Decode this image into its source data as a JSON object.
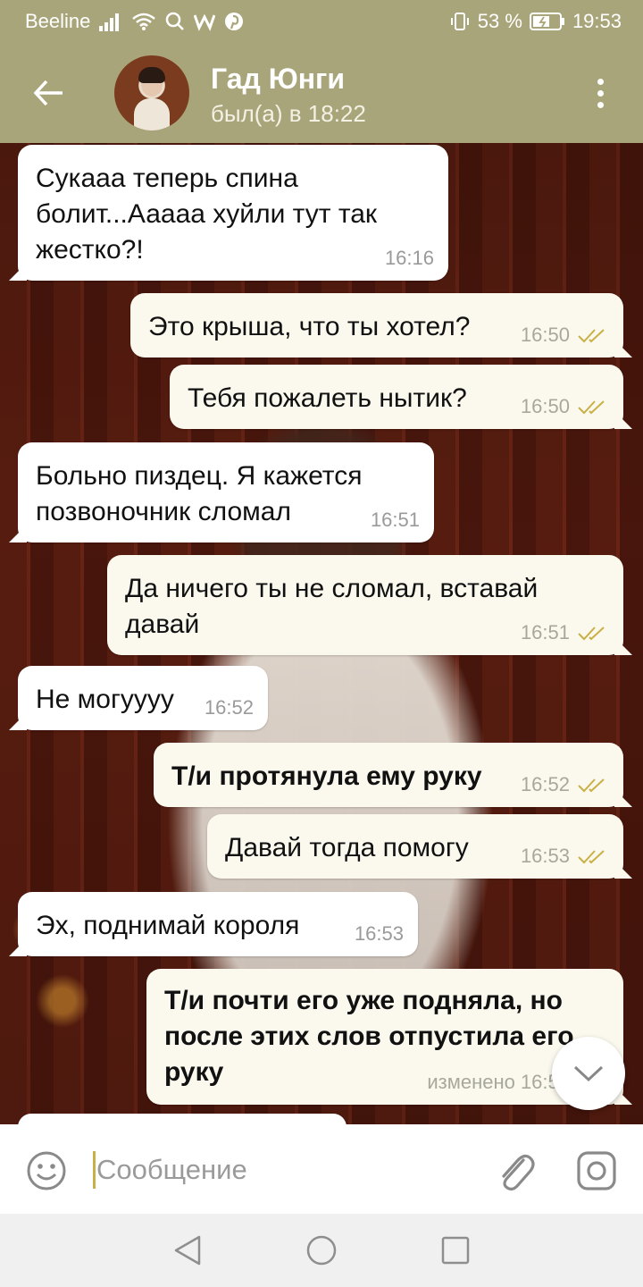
{
  "status_bar": {
    "carrier": "Beeline",
    "battery_percent": "53 %",
    "time": "19:53"
  },
  "header": {
    "back_icon": "arrow-left-icon",
    "contact_name": "Гад Юнги",
    "contact_status": "был(а) в 18:22",
    "menu_icon": "vertical-dots-icon"
  },
  "messages": [
    {
      "direction": "in",
      "text": "Сукааа теперь спина болит...Ааааа хуйли тут так жестко?!",
      "time": "16:16"
    },
    {
      "direction": "out",
      "text": "Это крыша, что ты хотел?",
      "time": "16:50",
      "read": true
    },
    {
      "direction": "out",
      "text": "Тебя пожалеть нытик?",
      "time": "16:50",
      "read": true
    },
    {
      "direction": "in",
      "text": "Больно пиздец. Я кажется позвоночник сломал",
      "time": "16:51"
    },
    {
      "direction": "out",
      "text": "Да ничего ты не сломал, вставай давай",
      "time": "16:51",
      "read": true
    },
    {
      "direction": "in",
      "text": "Не могуууу",
      "time": "16:52"
    },
    {
      "direction": "out",
      "text": "Т/и протянула ему руку",
      "time": "16:52",
      "read": true,
      "bold": true
    },
    {
      "direction": "out",
      "text": "Давай тогда помогу",
      "time": "16:53",
      "read": true
    },
    {
      "direction": "in",
      "text": "Эх, поднимай короля",
      "time": "16:53"
    },
    {
      "direction": "out",
      "text": "Т/и почти его уже подняла, но после этих слов отпустила его руку",
      "time": "изменено 16:53",
      "read": true,
      "bold": true
    }
  ],
  "input": {
    "placeholder": "Сообщение",
    "emoji_icon": "smiley-icon",
    "attach_icon": "paperclip-icon",
    "camera_icon": "camera-icon"
  },
  "scroll_down_icon": "chevron-down-icon",
  "nav": {
    "back_icon": "triangle-back-icon",
    "home_icon": "circle-home-icon",
    "recents_icon": "square-recents-icon"
  },
  "colors": {
    "header_bg": "#a9a57a",
    "outgoing_bubble": "#fbf9ee",
    "incoming_bubble": "#ffffff",
    "check_color": "#c9b046"
  }
}
